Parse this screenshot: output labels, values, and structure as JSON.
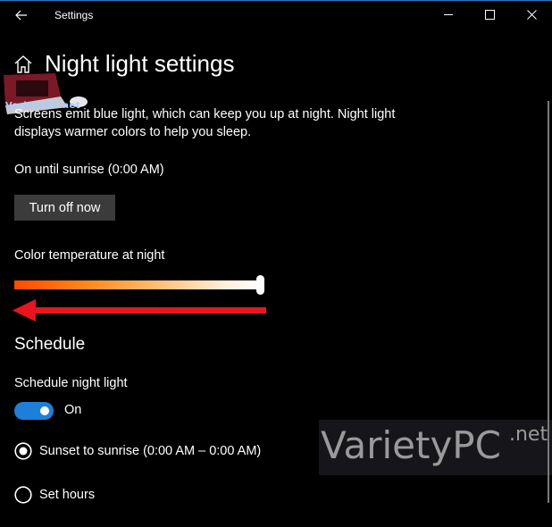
{
  "window": {
    "title": "Settings"
  },
  "page": {
    "title": "Night light settings"
  },
  "watermark": {
    "logo_text": "VarietyPC.net",
    "large_text": "VarietyPC",
    "suffix": ".net"
  },
  "description": "Screens emit blue light, which can keep you up at night. Night light displays warmer colors to help you sleep.",
  "status": "On until sunrise (0:00 AM)",
  "turn_off_button": "Turn off now",
  "color_temperature": {
    "label": "Color temperature at night",
    "value": 1.0
  },
  "schedule": {
    "heading": "Schedule",
    "toggle_label": "Schedule night light",
    "toggle_state": "On",
    "options": [
      {
        "label": "Sunset to sunrise (0:00 AM – 0:00 AM)",
        "selected": true
      },
      {
        "label": "Set hours",
        "selected": false
      }
    ]
  },
  "colors": {
    "accent": "#1e7fd8",
    "annotation_arrow": "#e8141e"
  },
  "icons": {
    "back": "back-arrow-icon",
    "home": "home-icon",
    "min": "minimize-icon",
    "max": "maximize-icon",
    "close": "close-icon"
  }
}
